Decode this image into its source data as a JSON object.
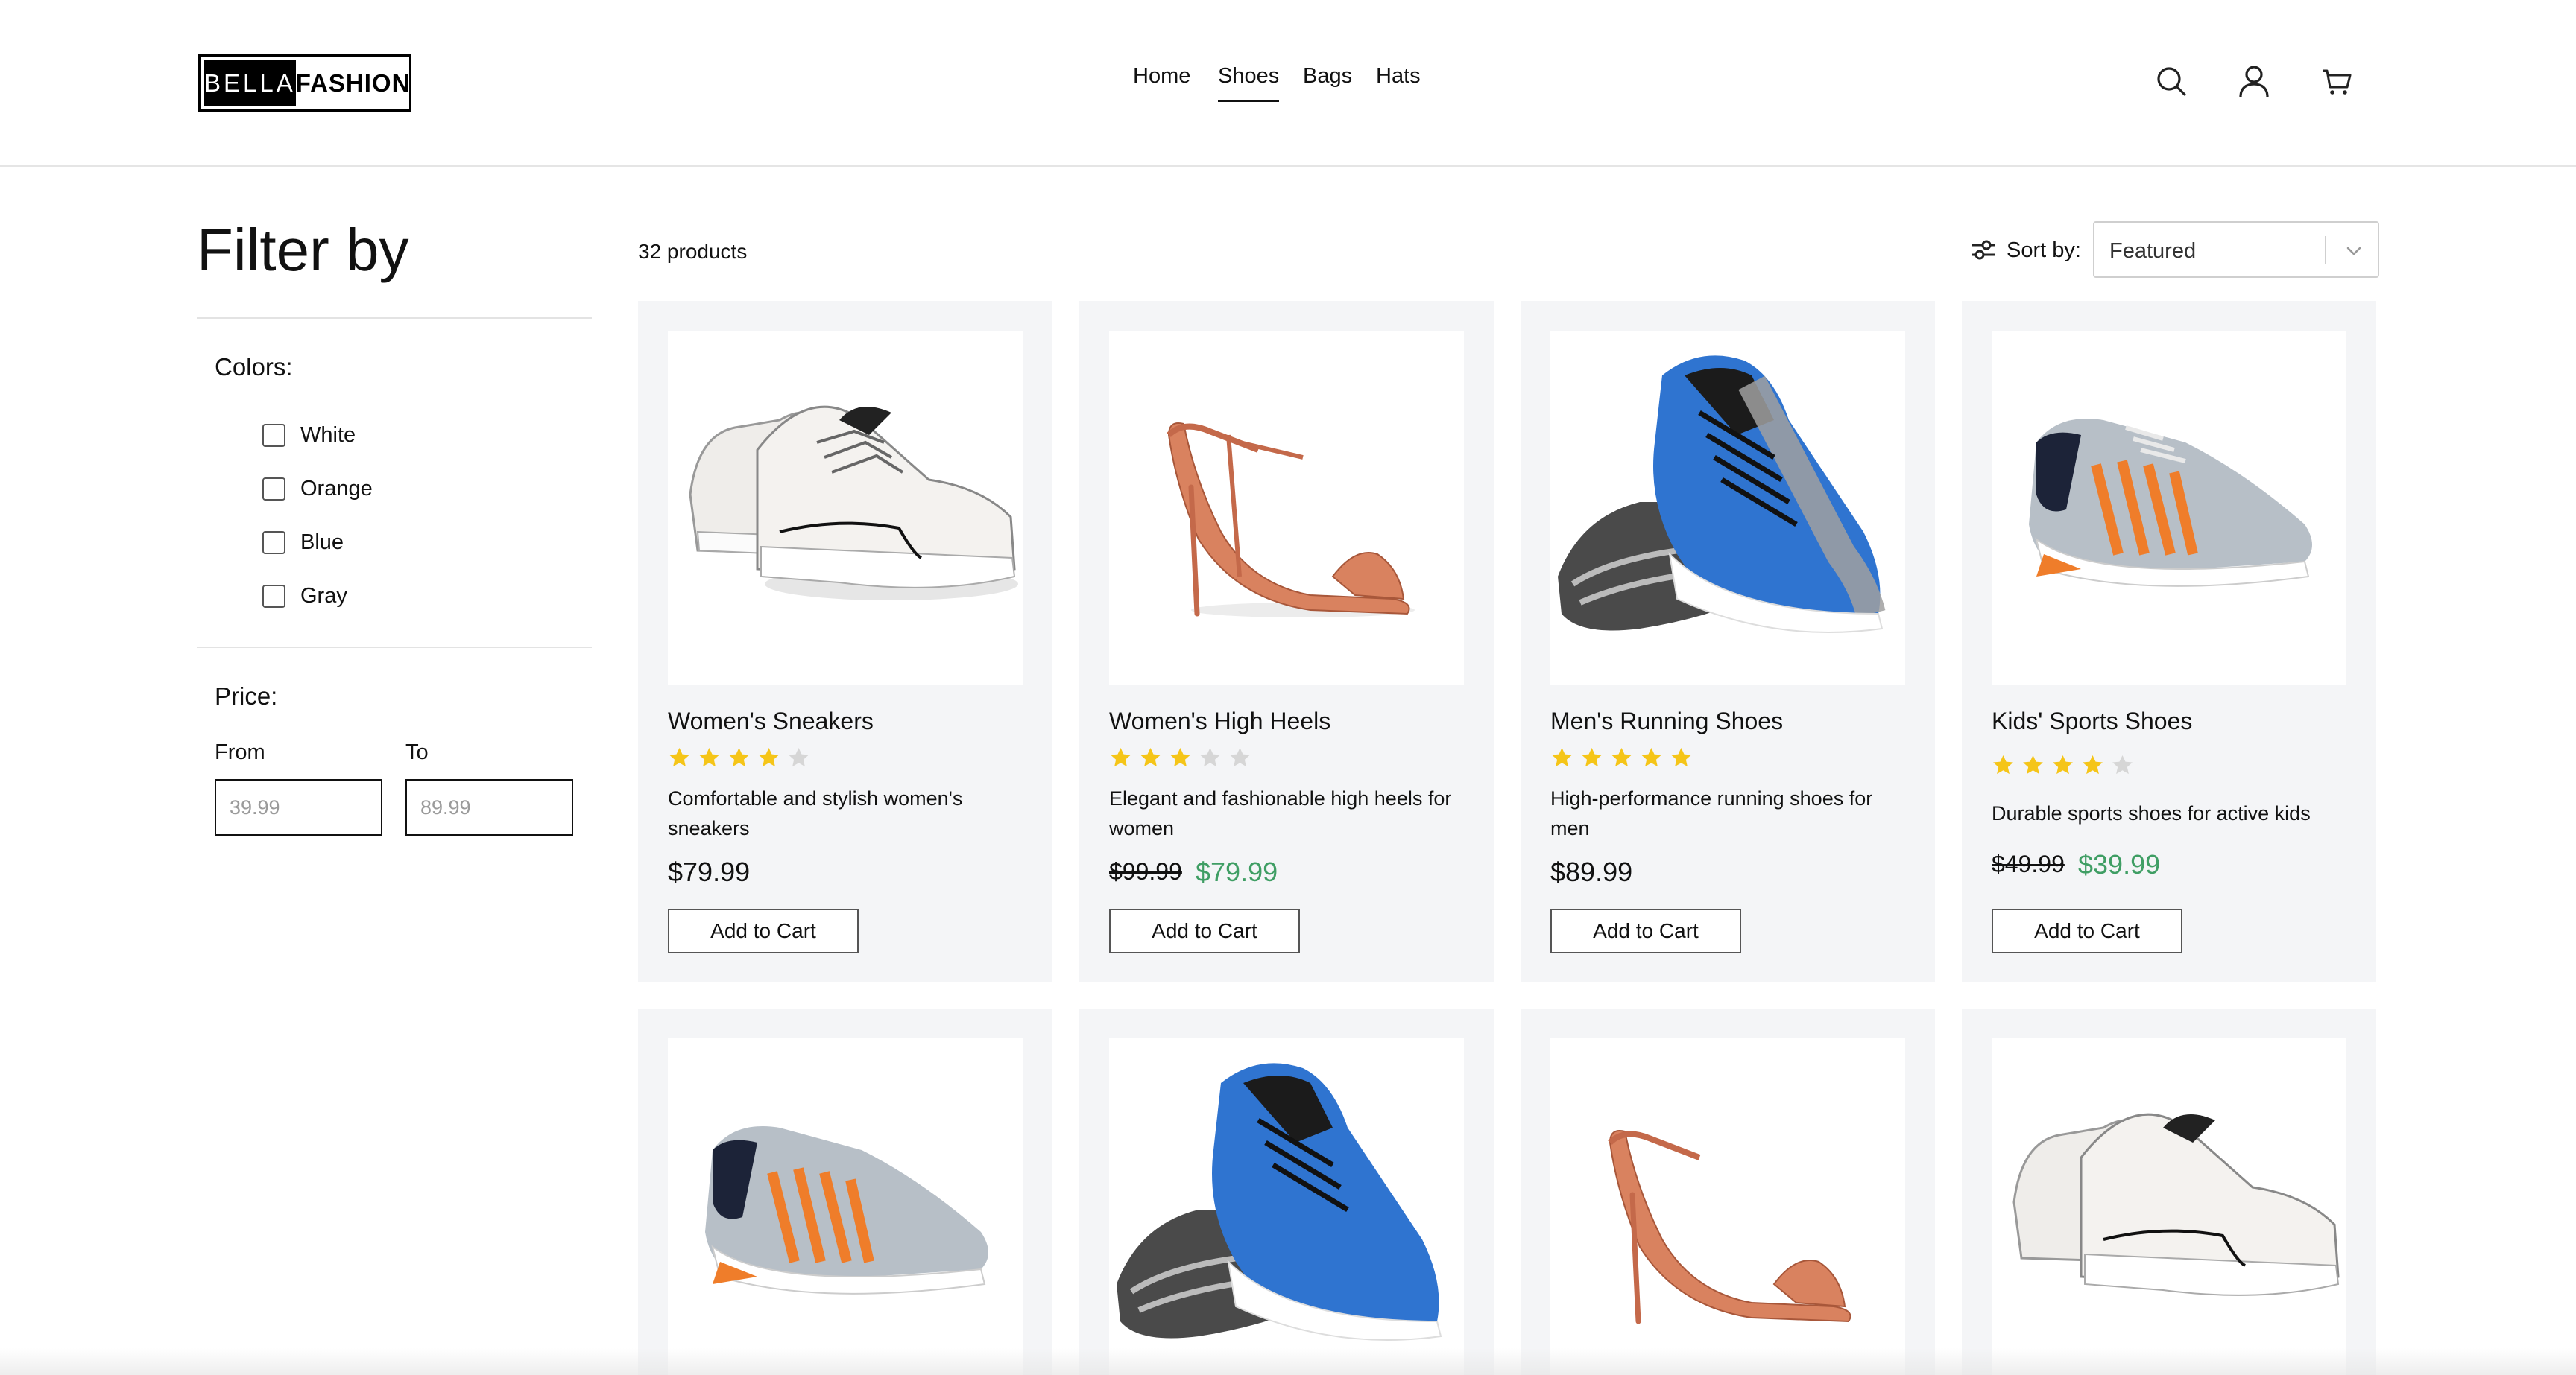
{
  "brand": {
    "part1": "BELLA",
    "part2": "FASHION"
  },
  "nav": {
    "home": "Home",
    "shoes": "Shoes",
    "bags": "Bags",
    "hats": "Hats",
    "active": "Shoes"
  },
  "header_icons": [
    "search-icon",
    "user-icon",
    "cart-icon"
  ],
  "sidebar": {
    "title": "Filter by",
    "colors_title": "Colors:",
    "colors": [
      "White",
      "Orange",
      "Blue",
      "Gray"
    ],
    "price_title": "Price:",
    "from_label": "From",
    "to_label": "To",
    "from_placeholder": "39.99",
    "to_placeholder": "89.99"
  },
  "toolbar": {
    "count": "32 products",
    "sort_label": "Sort by:",
    "sort_value": "Featured"
  },
  "theme": {
    "sale_color": "#3f9e64",
    "star_color": "#f5c518",
    "star_empty": "#d6d6d6",
    "card_bg": "#f4f5f7"
  },
  "products": [
    {
      "name": "Women's Sneakers",
      "rating": 4,
      "desc": "Comfortable and stylish women's sneakers",
      "price": "$79.99",
      "button": "Add to Cart"
    },
    {
      "name": "Women's High Heels",
      "rating": 3,
      "desc": "Elegant and fashionable high heels for women",
      "old_price": "$99.99",
      "sale_price": "$79.99",
      "button": "Add to Cart"
    },
    {
      "name": "Men's Running Shoes",
      "rating": 5,
      "desc": "High-performance running shoes for men",
      "price": "$89.99",
      "button": "Add to Cart"
    },
    {
      "name": "Kids' Sports Shoes",
      "rating": 4,
      "desc": "Durable sports shoes for active kids",
      "old_price": "$49.99",
      "sale_price": "$39.99",
      "button": "Add to Cart"
    }
  ]
}
